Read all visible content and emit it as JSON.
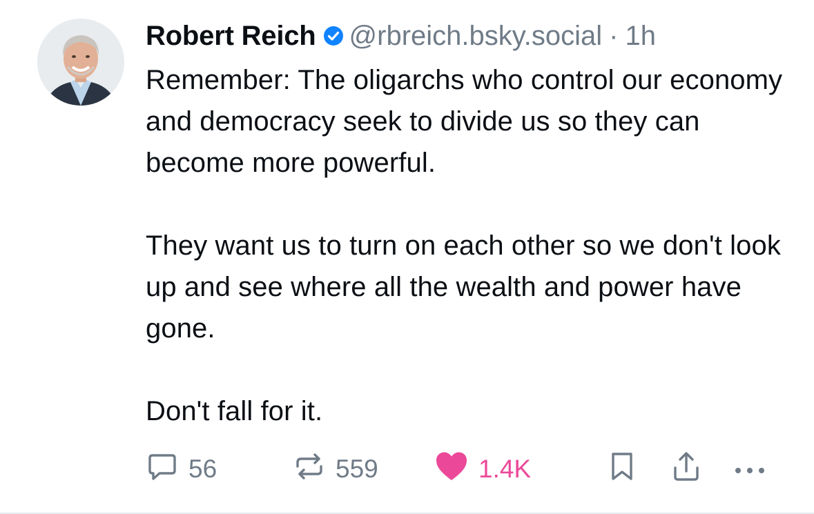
{
  "author": {
    "name": "Robert Reich",
    "handle": "@rbreich.bsky.social",
    "separator": "·",
    "time": "1h",
    "avatar_icon": "profile-photo",
    "verified_icon": "verified-check-icon",
    "verified_color": "#1083fe"
  },
  "post": {
    "text": "Remember: The oligarchs who control our economy and democracy seek to divide us so they can become more powerful.\n\nThey want us to turn on each other so we don't look up and see where all the wealth and power have gone.\n\nDon't fall for it."
  },
  "actions": {
    "reply_count": "56",
    "repost_count": "559",
    "like_count": "1.4K",
    "like_color": "#ec4899",
    "muted_color": "#6f7b87"
  }
}
